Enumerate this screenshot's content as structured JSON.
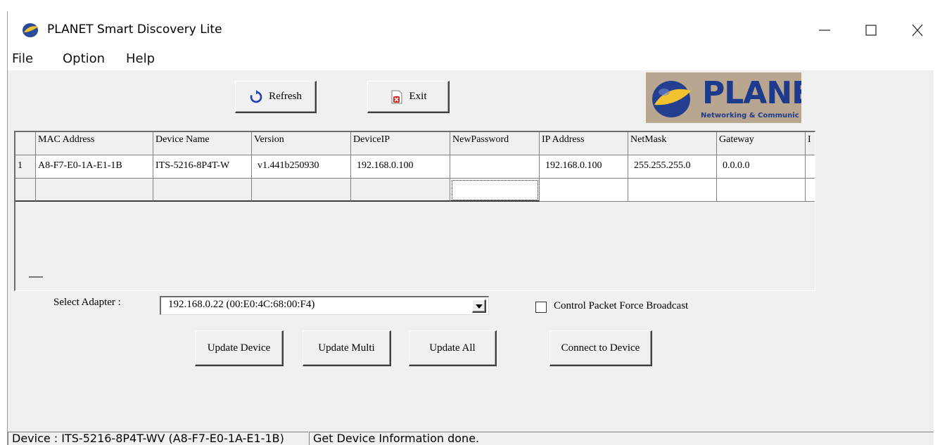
{
  "window": {
    "title": "PLANET Smart Discovery Lite",
    "icon": "planet-globe-icon",
    "controls": [
      "minimize-icon",
      "maximize-icon",
      "close-icon"
    ]
  },
  "menu": [
    "File",
    "Option",
    "Help"
  ],
  "toolbar": {
    "refresh_label": "Refresh",
    "exit_label": "Exit"
  },
  "logo": {
    "text": "PLANE",
    "tagline": "Networking & Communic",
    "colors": {
      "text": "#1d3a8c",
      "accent": "#f2c230"
    }
  },
  "table": {
    "columns": [
      "MAC Address",
      "Device Name",
      "Version",
      "DeviceIP",
      "NewPassword",
      "IP Address",
      "NetMask",
      "Gateway",
      "I"
    ],
    "rows": [
      {
        "index": "1",
        "cells": [
          "A8-F7-E0-1A-E1-1B",
          "ITS-5216-8P4T-W",
          "v1.441b250930",
          "192.168.0.100",
          "",
          "192.168.0.100",
          "255.255.255.0",
          "0.0.0.0",
          ""
        ]
      }
    ]
  },
  "adapter": {
    "label": "Select Adapter :",
    "selected": "192.168.0.22 (00:E0:4C:68:00:F4)"
  },
  "broadcast": {
    "label": "Control Packet Force Broadcast",
    "checked": false
  },
  "actions": {
    "update_device": "Update Device",
    "update_multi": "Update Multi",
    "update_all": "Update All",
    "connect": "Connect to Device"
  },
  "status": {
    "device": "Device : ITS-5216-8P4T-WV (A8-F7-E0-1A-E1-1B)",
    "message": "Get Device Information done."
  }
}
